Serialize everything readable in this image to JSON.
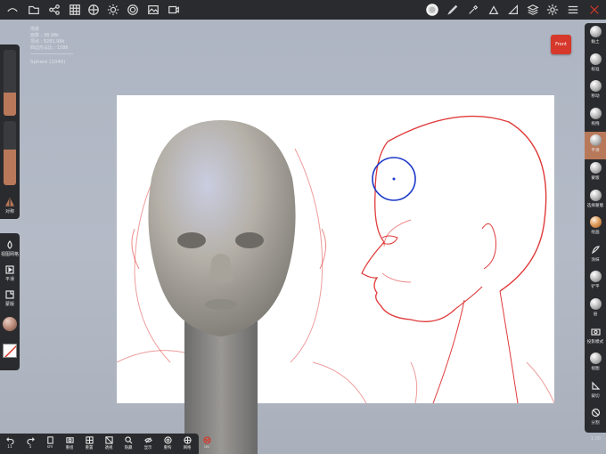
{
  "topbar": {
    "left_icons": [
      "app-logo-icon",
      "folder-icon",
      "share-icon",
      "grid-icon",
      "globe-icon",
      "sun-icon",
      "target-icon",
      "image-icon",
      "video-icon"
    ],
    "right_icons": [
      "brush-preview-icon",
      "pen-icon",
      "eyedropper-icon",
      "paint-icon",
      "triangle-icon",
      "layers-icon",
      "gear-icon",
      "sliders-icon",
      "close-x-icon"
    ]
  },
  "info": {
    "lines": [
      "场景",
      "面数 : 38.98k",
      "顶点 : 9281.98k",
      "四边形占比 : 1586"
    ],
    "selected": "Sphere (1046)"
  },
  "left_panel": {
    "radius_value": 0.35,
    "intensity_value": 0.55,
    "symmetry_label": "对称",
    "items": [
      {
        "label": "视图网格",
        "icon": "drop-icon"
      },
      {
        "label": "平滑",
        "icon": "play-square-icon"
      },
      {
        "label": "蒙版",
        "icon": "square-icon"
      }
    ]
  },
  "front_button": {
    "label": "Front"
  },
  "right_tools": [
    {
      "label": "黏土",
      "style": "ball"
    },
    {
      "label": "标准",
      "style": "ball"
    },
    {
      "label": "移动",
      "style": "ball"
    },
    {
      "label": "拖拽",
      "style": "ball"
    },
    {
      "label": "平滑",
      "style": "active"
    },
    {
      "label": "蒙版",
      "style": "ball"
    },
    {
      "label": "选择蒙版",
      "style": "ball"
    },
    {
      "label": "绘画",
      "style": "orange"
    },
    {
      "label": "涂抹",
      "style": "icon"
    },
    {
      "label": "铲平",
      "style": "ball"
    },
    {
      "label": "层",
      "style": "ball"
    },
    {
      "label": "投影模式",
      "style": "camera"
    },
    {
      "label": "视图",
      "style": "ball"
    },
    {
      "label": "裁切",
      "style": "trim"
    },
    {
      "label": "分割",
      "style": "split"
    }
  ],
  "bottom_bar": {
    "undo_count": "11",
    "redo_count": "5",
    "buttons": [
      "重组",
      "重置",
      "透视",
      "隐藏",
      "显示",
      "重构",
      "网格",
      "uv"
    ],
    "undo_label": "",
    "sm_label": "sm"
  },
  "colors": {
    "accent": "#b8785a",
    "active_red": "#d6382b",
    "ref_line": "#e03a3a",
    "ref_circle": "#1b39c8"
  },
  "watermark": "1.00"
}
